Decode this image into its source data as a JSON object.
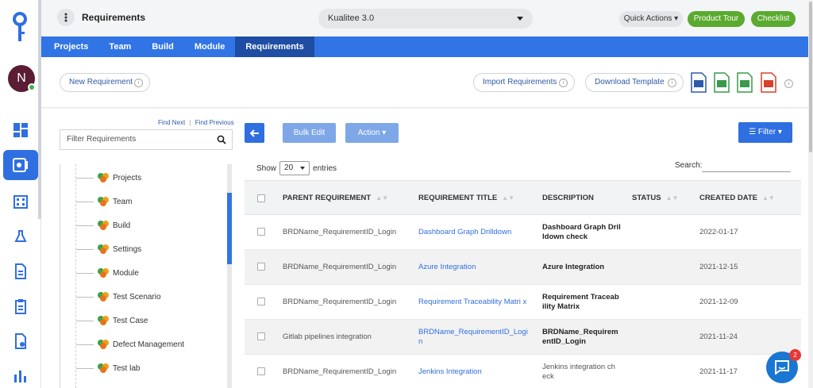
{
  "header": {
    "title": "Requirements",
    "project": "Kualitee 3.0",
    "quick_actions": "Quick Actions",
    "product_tour": "Product Tour",
    "checklist": "Checklist"
  },
  "user": {
    "initial": "N"
  },
  "nav": {
    "tabs": [
      "Projects",
      "Team",
      "Build",
      "Module",
      "Requirements"
    ],
    "active": "Requirements"
  },
  "toolbar": {
    "new_requirement": "New Requirement",
    "import_requirements": "Import Requirements",
    "download_template": "Download Template"
  },
  "tree": {
    "find_next": "Find Next",
    "separator": "|",
    "find_previous": "Find Previous",
    "filter_placeholder": "Filter Requirements",
    "nodes": [
      "Projects",
      "Team",
      "Build",
      "Settings",
      "Module",
      "Test Scenario",
      "Test Case",
      "Defect Management",
      "Test lab"
    ]
  },
  "list": {
    "bulk_edit": "Bulk Edit",
    "action": "Action",
    "filter": "Filter",
    "show_label": "Show",
    "show_value": "20",
    "entries_label": "entries",
    "search_label": "Search:"
  },
  "table": {
    "columns": [
      "PARENT REQUIREMENT",
      "REQUIREMENT TITLE",
      "DESCRIPTION",
      "STATUS",
      "CREATED DATE"
    ],
    "rows": [
      {
        "parent": "BRDName_RequirementID_Login",
        "title": "Dashboard Graph Drilldown",
        "description": "Dashboard Graph Dril ldown check",
        "status": "",
        "date": "2022-01-17"
      },
      {
        "parent": "BRDName_RequirementID_Login",
        "title": "Azure Integration",
        "description": "Azure Integration",
        "status": "",
        "date": "2021-12-15"
      },
      {
        "parent": "BRDName_RequirementID_Login",
        "title": "Requirement Traceability Matri x",
        "description": "Requirement Traceab ility Matrix",
        "status": "",
        "date": "2021-12-09"
      },
      {
        "parent": "Gitlab pipelines integration",
        "title": "BRDName_RequirementID_Logi n",
        "description": "BRDName_Requirem entID_Login",
        "status": "",
        "date": "2021-11-24"
      },
      {
        "parent": "BRDName_RequirementID_Login",
        "title": "Jenkins Integration",
        "description": "Jenkins integration ch eck",
        "status": "",
        "date": "2021-11-17"
      }
    ]
  },
  "chat": {
    "badge": "2"
  },
  "colors": {
    "primary": "#3174e6",
    "nav_active": "#1f4da3",
    "green": "#5aaa2f",
    "link": "#2f6fe0"
  }
}
